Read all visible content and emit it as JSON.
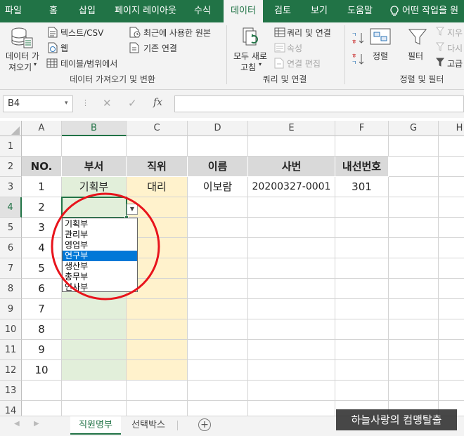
{
  "tabs": [
    "파일",
    "홈",
    "삽입",
    "페이지 레이아웃",
    "수식",
    "데이터",
    "검토",
    "보기",
    "도움말",
    "어떤 작업을 원"
  ],
  "active_tab": "데이터",
  "ribbon": {
    "get_data": [
      "데이터 가",
      "져오기"
    ],
    "text_csv": "텍스트/CSV",
    "web": "웹",
    "table_range": "테이블/범위에서",
    "recent_sources": "최근에 사용한 원본",
    "existing_connections": "기존 연결",
    "refresh_all": [
      "모두 새로",
      "고침"
    ],
    "queries_connections": "쿼리 및 연결",
    "properties": "속성",
    "edit_links": "연결 편집",
    "sort": "정렬",
    "filter": "필터",
    "clear": "지우",
    "reapply": "다시",
    "advanced": "고급",
    "groups": [
      "데이터 가져오기 및 변환",
      "쿼리 및 연결",
      "정렬 및 필터"
    ]
  },
  "formula_bar": {
    "name_box": "B4",
    "formula": ""
  },
  "columns": [
    "A",
    "B",
    "C",
    "D",
    "E",
    "F",
    "G",
    "H"
  ],
  "selected_column": "B",
  "rows": [
    "1",
    "2",
    "3",
    "4",
    "5",
    "6",
    "7",
    "8",
    "9",
    "10",
    "11",
    "12",
    "13",
    "14"
  ],
  "selected_row": "4",
  "table": {
    "headers": [
      "NO.",
      "부서",
      "직위",
      "이름",
      "사번",
      "내선번호"
    ],
    "record": [
      "1",
      "기획부",
      "대리",
      "이보람",
      "20200327-0001",
      "301"
    ],
    "numbers": [
      "2",
      "3",
      "4",
      "5",
      "6",
      "7",
      "8",
      "9",
      "10"
    ]
  },
  "dropdown": {
    "options": [
      "기획부",
      "관리부",
      "영업부",
      "연구부",
      "생산부",
      "총무부",
      "인사부"
    ],
    "highlighted": "연구부"
  },
  "sheets": [
    "직원명부",
    "선택박스"
  ],
  "active_sheet": "직원명부",
  "watermark": "하늘사랑의 컴맹탈출",
  "colors": {
    "excel_green": "#217346",
    "highlight": "#0078d7",
    "circle": "#e8141c",
    "dept_fill": "#e2efda",
    "title_fill": "#fff2cc",
    "header_fill": "#d9d9d9"
  }
}
